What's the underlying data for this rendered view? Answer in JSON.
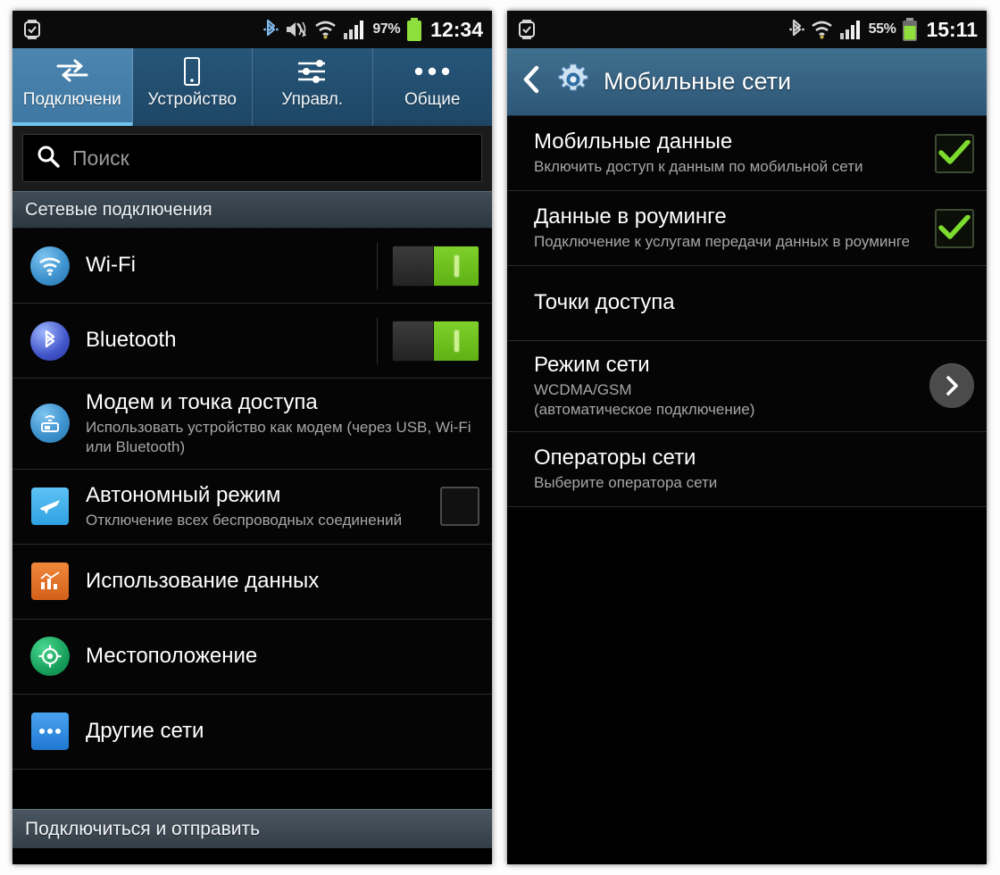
{
  "left_phone": {
    "status_bar": {
      "icons": [
        "watch-icon",
        "bluetooth-icon",
        "mute-icon",
        "wifi-icon",
        "signal-icon"
      ],
      "battery_percent": "97%",
      "clock": "12:34"
    },
    "tabs": [
      {
        "label": "Подключени",
        "icon": "connections-arrows-icon",
        "active": true
      },
      {
        "label": "Устройство",
        "icon": "device-phone-icon",
        "active": false
      },
      {
        "label": "Управл.",
        "icon": "sliders-icon",
        "active": false
      },
      {
        "label": "Общие",
        "icon": "more-dots-icon",
        "active": false
      }
    ],
    "search": {
      "placeholder": "Поиск",
      "icon": "search-icon"
    },
    "section_header": "Сетевые подключения",
    "items": [
      {
        "title": "Wi-Fi",
        "sub": "",
        "icon": "wifi-circle-icon",
        "control": "toggle-on"
      },
      {
        "title": "Bluetooth",
        "sub": "",
        "icon": "bluetooth-circle-icon",
        "control": "toggle-on"
      },
      {
        "title": "Модем и точка доступа",
        "sub": "Использовать устройство как модем (через USB, Wi-Fi или Bluetooth)",
        "icon": "tethering-icon",
        "control": "none"
      },
      {
        "title": "Автономный режим",
        "sub": "Отключение всех беспроводных соединений",
        "icon": "airplane-icon",
        "control": "checkbox-off"
      },
      {
        "title": "Использование данных",
        "sub": "",
        "icon": "data-usage-icon",
        "control": "none"
      },
      {
        "title": "Местоположение",
        "sub": "",
        "icon": "location-icon",
        "control": "none"
      },
      {
        "title": "Другие сети",
        "sub": "",
        "icon": "other-networks-icon",
        "control": "none"
      }
    ],
    "footer": "Подключиться и отправить"
  },
  "right_phone": {
    "status_bar": {
      "icons": [
        "watch-icon",
        "bluetooth-icon",
        "wifi-icon",
        "signal-icon"
      ],
      "battery_percent": "55%",
      "clock": "15:11"
    },
    "action_bar": {
      "back_icon": "back-chevron-icon",
      "app_icon": "settings-gear-icon",
      "title": "Мобильные сети"
    },
    "items": [
      {
        "title": "Мобильные данные",
        "sub": "Включить доступ к данным по мобильной сети",
        "control": "checkbox-on"
      },
      {
        "title": "Данные в роуминге",
        "sub": "Подключение к услугам передачи данных в роуминге",
        "control": "checkbox-on"
      },
      {
        "title": "Точки доступа",
        "sub": "",
        "control": "none"
      },
      {
        "title": "Режим сети",
        "sub": "WCDMA/GSM\n(автоматическое подключение)",
        "control": "chevron"
      },
      {
        "title": "Операторы сети",
        "sub": "Выберите оператора сети",
        "control": "none"
      }
    ]
  },
  "colors": {
    "accent_blue": "#3e77a1",
    "tab_active": "#4c86b0",
    "toggle_green": "#6fc31c",
    "check_green": "#7ddb2e",
    "background": "#000000"
  }
}
